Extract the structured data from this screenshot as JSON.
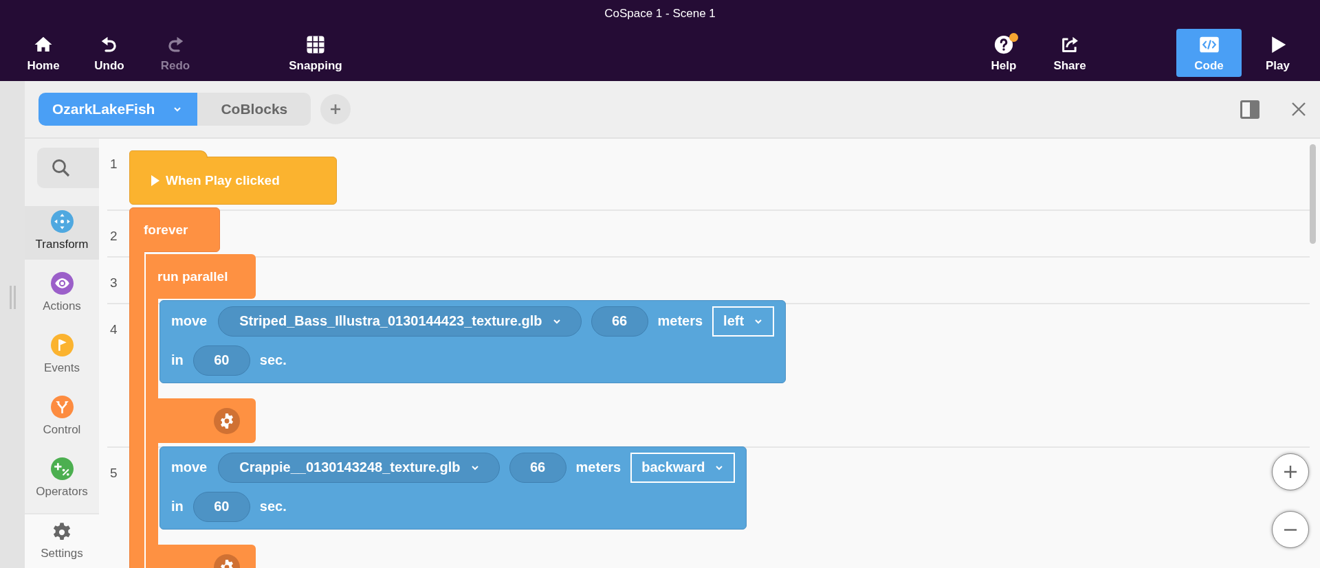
{
  "toolbar": {
    "title": "CoSpace 1 - Scene 1",
    "left": [
      {
        "label": "Home",
        "kind": "home",
        "disabled": false
      },
      {
        "label": "Undo",
        "kind": "undo",
        "disabled": false
      },
      {
        "label": "Redo",
        "kind": "redo",
        "disabled": true
      }
    ],
    "snapping": {
      "label": "Snapping",
      "kind": "grid"
    },
    "right": [
      {
        "label": "Help",
        "kind": "help",
        "badge": true
      },
      {
        "label": "Share",
        "kind": "share",
        "badge": false
      }
    ],
    "modes": [
      {
        "label": "Code",
        "kind": "code",
        "selected": true
      },
      {
        "label": "Play",
        "kind": "play",
        "selected": false
      }
    ]
  },
  "tabs": [
    {
      "label": "OzarkLakeFish",
      "selected": true
    },
    {
      "label": "CoBlocks",
      "selected": false
    }
  ],
  "categories": [
    {
      "label": "Transform",
      "kind": "transform",
      "color": "#4fa8e0",
      "selected": true
    },
    {
      "label": "Actions",
      "kind": "actions",
      "color": "#9b5fc9",
      "selected": false
    },
    {
      "label": "Events",
      "kind": "events",
      "color": "#fbb32f",
      "selected": false
    },
    {
      "label": "Control",
      "kind": "control",
      "color": "#fd8c40",
      "selected": false
    },
    {
      "label": "Operators",
      "kind": "operators",
      "color": "#4caf50",
      "selected": false
    }
  ],
  "settings": {
    "label": "Settings"
  },
  "line_numbers": [
    "1",
    "2",
    "3",
    "4",
    "5"
  ],
  "script": [
    {
      "kind": "hat",
      "label": "When Play clicked"
    },
    {
      "kind": "loop",
      "label": "forever",
      "children": [
        {
          "kind": "parallel",
          "label": "run parallel",
          "branches": [
            {
              "kind": "move",
              "verb": "move",
              "object": "Striped_Bass_Illustra_0130144423_texture.glb",
              "distance": "66",
              "unit": "meters",
              "direction": "left",
              "time_prefix": "in",
              "time": "60",
              "time_unit": "sec."
            },
            {
              "kind": "move",
              "verb": "move",
              "object": "Crappie__0130143248_texture.glb",
              "distance": "66",
              "unit": "meters",
              "direction": "backward",
              "time_prefix": "in",
              "time": "60",
              "time_unit": "sec."
            }
          ]
        }
      ]
    }
  ]
}
